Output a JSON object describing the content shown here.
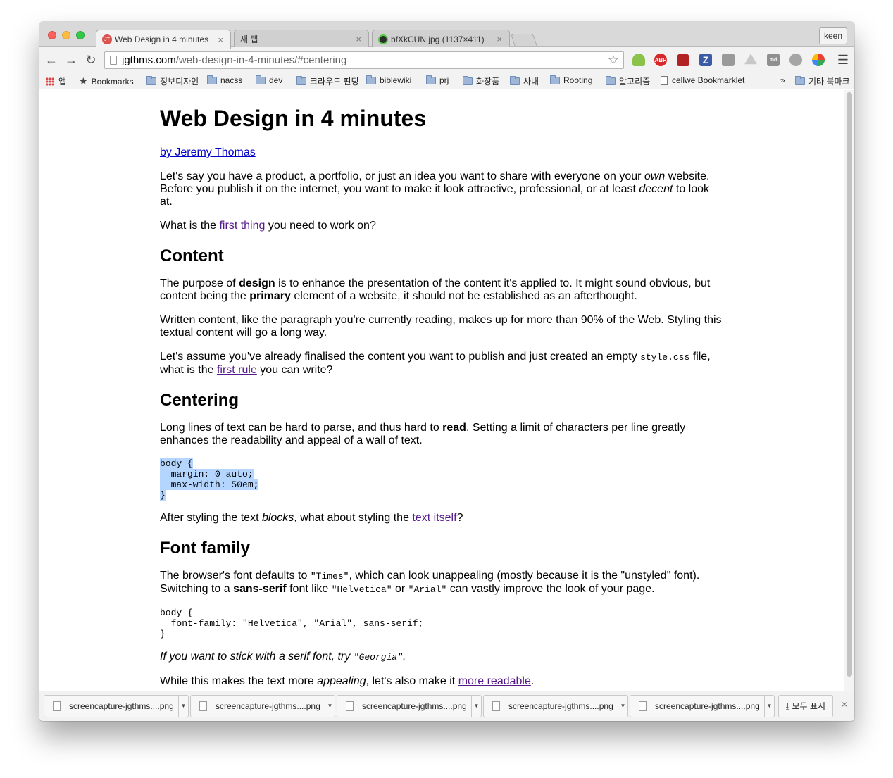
{
  "browser": {
    "tabs": [
      {
        "title": "Web Design in 4 minutes",
        "favicon": "JT",
        "active": true
      },
      {
        "title": "새 탭",
        "favicon": "",
        "active": false
      },
      {
        "title": "bfXkCUN.jpg (1137×411)",
        "favicon": "",
        "active": false
      }
    ],
    "profile_name": "keen",
    "url_domain": "jgthms.com",
    "url_path": "/web-design-in-4-minutes/#centering",
    "extensions": [
      "android-icon",
      "adblock-plus-icon",
      "couch-icon",
      "z-icon",
      "camera-icon",
      "drive-icon",
      "md-icon",
      "monkey-icon",
      "pinwheel-icon"
    ],
    "ext_labels": {
      "abp": "ABP",
      "z": "Z",
      "md": "md"
    }
  },
  "bookmarks": {
    "apps": "앱",
    "items": [
      "Bookmarks",
      "정보디자인",
      "nacss",
      "dev",
      "크라우드 펀딩",
      "biblewiki",
      "prj",
      "화장품",
      "사내",
      "Rooting",
      "알고리즘",
      "cellwe Bookmarklet"
    ],
    "overflow": "»",
    "other": "기타 북마크"
  },
  "article": {
    "title": "Web Design in 4 minutes",
    "byline": "by Jeremy Thomas",
    "intro_1a": "Let's say you have a product, a portfolio, or just an idea you want to share with everyone on your ",
    "intro_1_em": "own",
    "intro_1b": " website. Before you publish it on the internet, you want to make it look attractive, professional, or at least ",
    "intro_1_em2": "decent",
    "intro_1c": " to look at.",
    "intro_2a": "What is the ",
    "intro_2_link": "first thing",
    "intro_2b": " you need to work on?",
    "h_content": "Content",
    "content_1a": "The purpose of ",
    "content_1_b1": "design",
    "content_1b": " is to enhance the presentation of the content it's applied to. It might sound obvious, but content being the ",
    "content_1_b2": "primary",
    "content_1c": " element of a website, it should not be established as an afterthought.",
    "content_2": "Written content, like the paragraph you're currently reading, makes up for more than 90% of the Web. Styling this textual content will go a long way.",
    "content_3a": "Let's assume you've already finalised the content you want to publish and just created an empty ",
    "content_3_code": "style.css",
    "content_3b": " file, what is the ",
    "content_3_link": "first rule",
    "content_3c": " you can write?",
    "h_centering": "Centering",
    "centering_1a": "Long lines of text can be hard to parse, and thus hard to ",
    "centering_1_b": "read",
    "centering_1b": ". Setting a limit of characters per line greatly enhances the readability and appeal of a wall of text.",
    "code_1": [
      "body {",
      "  margin: 0 auto;",
      "  max-width: 50em;",
      "}"
    ],
    "centering_2a": "After styling the text ",
    "centering_2_em": "blocks",
    "centering_2b": ", what about styling the ",
    "centering_2_link": "text itself",
    "centering_2c": "?",
    "h_font": "Font family",
    "font_1a": "The browser's font defaults to ",
    "font_1_code1": "\"Times\"",
    "font_1b": ", which can look unappealing (mostly because it is the \"unstyled\" font). Switching to a ",
    "font_1_b": "sans-serif",
    "font_1c": " font like ",
    "font_1_code2": "\"Helvetica\"",
    "font_1d": " or ",
    "font_1_code3": "\"Arial\"",
    "font_1e": " can vastly improve the look of your page.",
    "code_2": [
      "body {",
      "  font-family: \"Helvetica\", \"Arial\", sans-serif;",
      "}"
    ],
    "font_2a": "If you want to stick with a serif font, try ",
    "font_2_code": "\"Georgia\"",
    "font_2b": ".",
    "font_3a": "While this makes the text more ",
    "font_3_em": "appealing",
    "font_3b": ", let's also make it ",
    "font_3_link": "more readable",
    "font_3c": "."
  },
  "downloads": {
    "items": [
      "screencapture-jgthms....png",
      "screencapture-jgthms....png",
      "screencapture-jgthms....png",
      "screencapture-jgthms....png",
      "screencapture-jgthms....png"
    ],
    "show_all": "모두 표시",
    "close": "×"
  }
}
